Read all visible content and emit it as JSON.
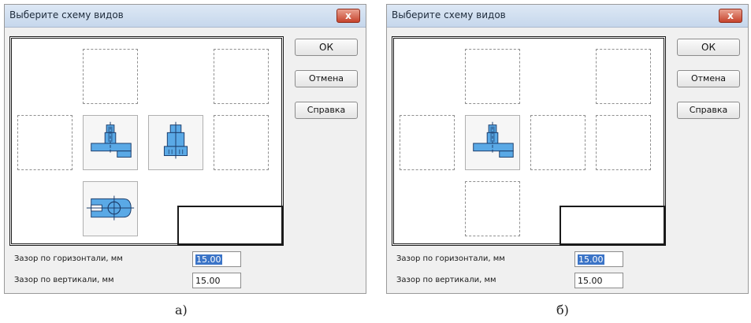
{
  "dialogs": [
    {
      "title": "Выберите схему видов",
      "close_label": "x",
      "buttons": {
        "ok": "ОК",
        "cancel": "Отмена",
        "help": "Справка"
      },
      "fields": [
        {
          "label": "Зазор по горизонтали, мм",
          "value": "15.00",
          "selected": true
        },
        {
          "label": "Зазор по вертикали, мм",
          "value": "15.00",
          "selected": false
        }
      ],
      "views": {
        "top_left": "empty",
        "top_right": "empty",
        "left": "empty",
        "front": "front-view-icon",
        "right": "side-view-icon",
        "far_right": "empty",
        "bottom": "top-view-icon"
      },
      "caption": "а)"
    },
    {
      "title": "Выберите схему видов",
      "close_label": "x",
      "buttons": {
        "ok": "ОК",
        "cancel": "Отмена",
        "help": "Справка"
      },
      "fields": [
        {
          "label": "Зазор по горизонтали, мм",
          "value": "15.00",
          "selected": true
        },
        {
          "label": "Зазор по вертикали, мм",
          "value": "15.00",
          "selected": false
        }
      ],
      "views": {
        "top_left": "empty",
        "top_right": "empty",
        "left": "empty",
        "front": "front-view-icon",
        "right": "empty",
        "far_right": "empty",
        "bottom": "empty"
      },
      "caption": "б)"
    }
  ],
  "colors": {
    "part_fill": "#5aa9e6",
    "part_stroke": "#1c3d6b",
    "selection": "#3b74c7"
  }
}
